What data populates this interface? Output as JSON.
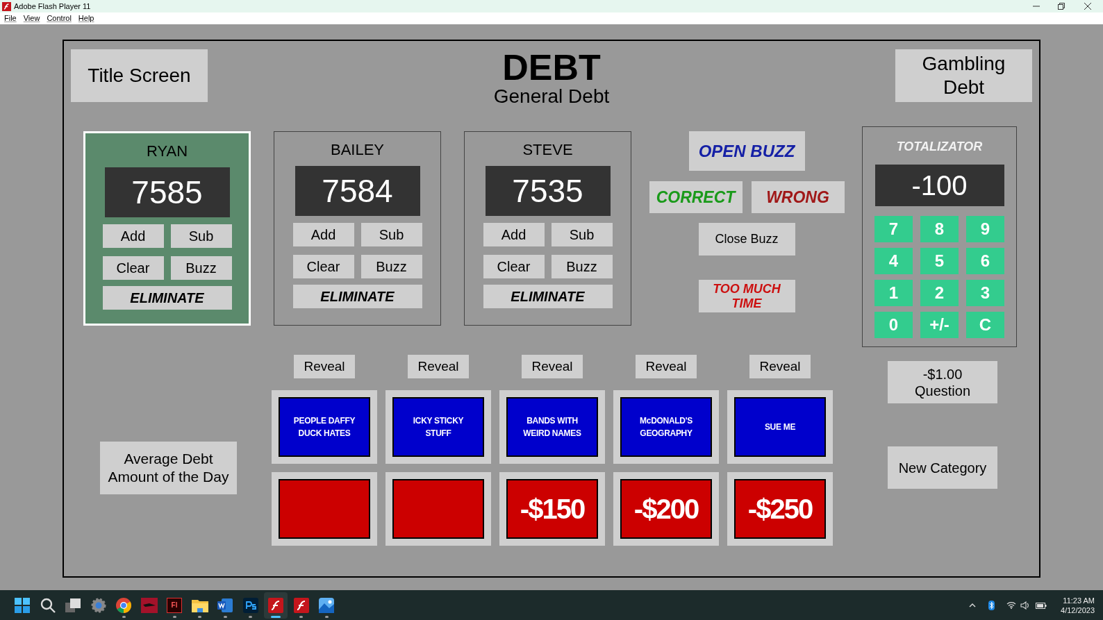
{
  "window": {
    "title": "Adobe Flash Player 11"
  },
  "menu": [
    "File",
    "View",
    "Control",
    "Help"
  ],
  "header": {
    "left_button": "Title Screen",
    "title": "DEBT",
    "subtitle": "General Debt",
    "right_button": "Gambling Debt"
  },
  "players": [
    {
      "name": "RYAN",
      "score": "7585",
      "selected": true,
      "buttons": [
        "Add",
        "Sub",
        "Clear",
        "Buzz"
      ],
      "eliminate": "ELIMINATE"
    },
    {
      "name": "BAILEY",
      "score": "7584",
      "selected": false,
      "buttons": [
        "Add",
        "Sub",
        "Clear",
        "Buzz"
      ],
      "eliminate": "ELIMINATE"
    },
    {
      "name": "STEVE",
      "score": "7535",
      "selected": false,
      "buttons": [
        "Add",
        "Sub",
        "Clear",
        "Buzz"
      ],
      "eliminate": "ELIMINATE"
    }
  ],
  "buzz": {
    "open": "OPEN BUZZ",
    "correct": "CORRECT",
    "wrong": "WRONG",
    "close": "Close Buzz",
    "too_much_time": "TOO MUCH TIME"
  },
  "totalizator": {
    "title": "TOTALIZATOR",
    "display": "-100",
    "keys": [
      "7",
      "8",
      "9",
      "4",
      "5",
      "6",
      "1",
      "2",
      "3",
      "0",
      "+/-",
      "C"
    ]
  },
  "board": [
    {
      "reveal": "Reveal",
      "category": "PEOPLE DAFFY DUCK HATES"
    },
    {
      "reveal": "Reveal",
      "category": "ICKY STICKY STUFF"
    },
    {
      "reveal": "Reveal",
      "category": "BANDS WITH WEIRD NAMES",
      "value": "-$150"
    },
    {
      "reveal": "Reveal",
      "category": "McDONALD'S GEOGRAPHY",
      "value": "-$200"
    },
    {
      "reveal": "Reveal",
      "category": "SUE ME",
      "value": "-$250"
    }
  ],
  "side": {
    "average": "Average Debt Amount of the Day",
    "question": "-$1.00 Question",
    "new_category": "New Category"
  },
  "taskbar": {
    "apps": [
      {
        "kind": "start",
        "running": false,
        "selected": false
      },
      {
        "kind": "search",
        "running": false,
        "selected": false
      },
      {
        "kind": "taskview",
        "running": false,
        "selected": false
      },
      {
        "kind": "settings",
        "running": false,
        "selected": false
      },
      {
        "kind": "chrome",
        "running": true,
        "selected": false
      },
      {
        "kind": "redapp",
        "running": false,
        "selected": false
      },
      {
        "kind": "animate",
        "label": "Fl",
        "running": true,
        "selected": false
      },
      {
        "kind": "folder",
        "running": true,
        "selected": false
      },
      {
        "kind": "word",
        "running": true,
        "selected": false
      },
      {
        "kind": "photoshop",
        "running": true,
        "selected": false
      },
      {
        "kind": "flash",
        "running": true,
        "selected": true
      },
      {
        "kind": "flash",
        "running": true,
        "selected": false
      },
      {
        "kind": "photos",
        "running": true,
        "selected": false
      }
    ],
    "time": "11:23 AM",
    "date": "4/12/2023"
  }
}
